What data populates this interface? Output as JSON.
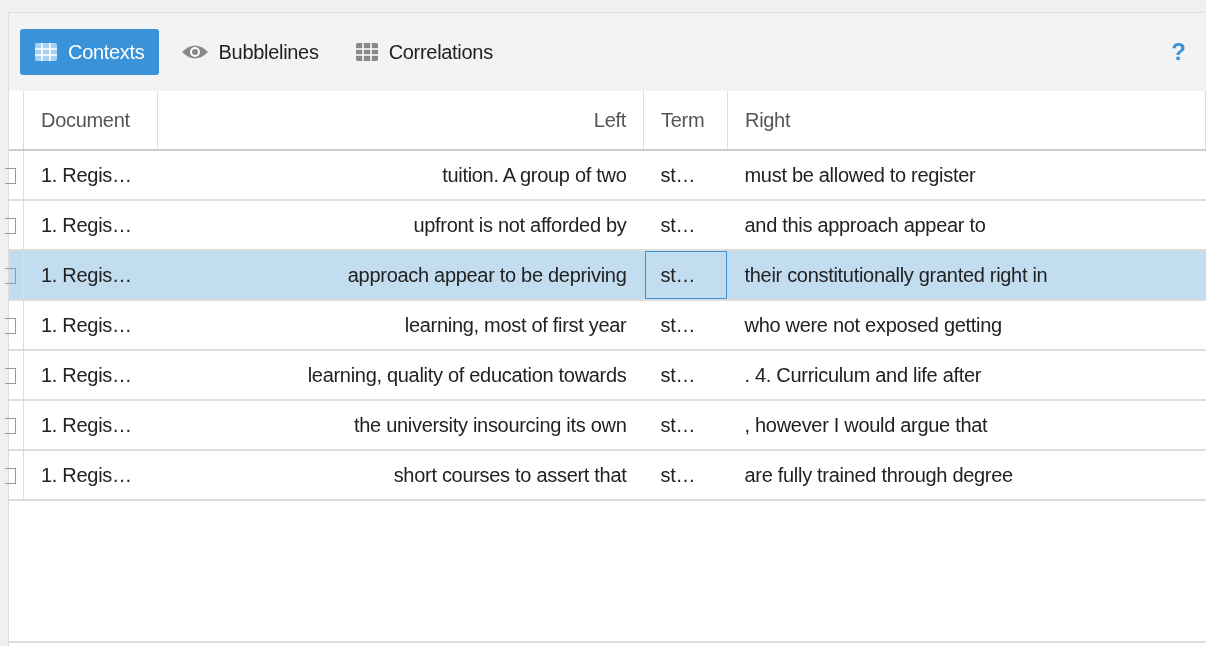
{
  "tabs": [
    {
      "label": "Contexts",
      "kind": "grid",
      "selected": true
    },
    {
      "label": "Bubblelines",
      "kind": "eye",
      "selected": false
    },
    {
      "label": "Correlations",
      "kind": "grid",
      "selected": false
    }
  ],
  "help": "?",
  "table": {
    "columns": [
      "Document",
      "Left",
      "Term",
      "Right"
    ],
    "rows": [
      {
        "document": "1. Regis…",
        "left": "tuition. A group of two",
        "term": "st…",
        "right": "must be allowed to register",
        "selected": false,
        "focused": false
      },
      {
        "document": "1. Regis…",
        "left": "upfront is not afforded by",
        "term": "st…",
        "right": "and this approach appear to",
        "selected": false,
        "focused": false
      },
      {
        "document": "1. Regis…",
        "left": "approach appear to be depriving",
        "term": "st…",
        "right": "their constitutionally granted right in",
        "selected": true,
        "focused": true
      },
      {
        "document": "1. Regis…",
        "left": "learning, most of first year",
        "term": "st…",
        "right": "who were not exposed getting",
        "selected": false,
        "focused": false
      },
      {
        "document": "1. Regis…",
        "left": "learning, quality of education towards",
        "term": "st…",
        "right": ". 4. Curriculum and life after",
        "selected": false,
        "focused": false
      },
      {
        "document": "1. Regis…",
        "left": "the university insourcing its own",
        "term": "st…",
        "right": ", however I would argue that",
        "selected": false,
        "focused": false
      },
      {
        "document": "1. Regis…",
        "left": "short courses to assert that",
        "term": "st…",
        "right": "are fully trained through degree",
        "selected": false,
        "focused": false
      }
    ]
  }
}
